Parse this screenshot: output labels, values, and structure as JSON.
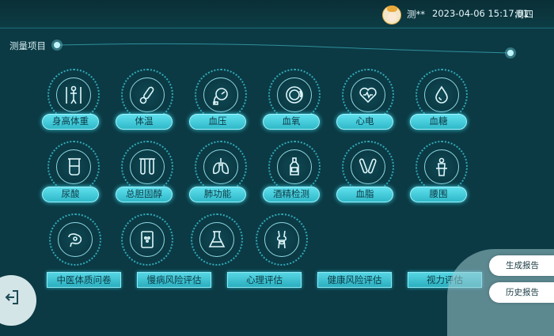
{
  "header": {
    "user_name": "测**",
    "datetime": "2023-04-06 15:17:01",
    "weekday": "周四"
  },
  "section": {
    "title": "测量项目"
  },
  "measurements": [
    {
      "label": "身高体重",
      "icon": "height-weight-icon"
    },
    {
      "label": "体温",
      "icon": "thermometer-icon"
    },
    {
      "label": "血压",
      "icon": "blood-pressure-icon"
    },
    {
      "label": "血氧",
      "icon": "blood-oxygen-icon"
    },
    {
      "label": "心电",
      "icon": "heart-icon"
    },
    {
      "label": "血糖",
      "icon": "blood-drop-icon"
    },
    {
      "label": "尿酸",
      "icon": "beaker-icon"
    },
    {
      "label": "总胆固醇",
      "icon": "test-tubes-icon"
    },
    {
      "label": "肺功能",
      "icon": "lungs-icon"
    },
    {
      "label": "酒精检测",
      "icon": "bottle-icon"
    },
    {
      "label": "血脂",
      "icon": "blood-tubes-icon"
    },
    {
      "label": "腰围",
      "icon": "waist-icon"
    }
  ],
  "extra_icons": [
    "stomach-icon",
    "test-card-icon",
    "flask-icon",
    "joint-icon"
  ],
  "assessments": [
    "中医体质问卷",
    "慢病风险评估",
    "心理评估",
    "健康风险评估",
    "视力评估"
  ],
  "side_buttons": {
    "generate_report": "生成报告",
    "history_report": "历史报告"
  }
}
